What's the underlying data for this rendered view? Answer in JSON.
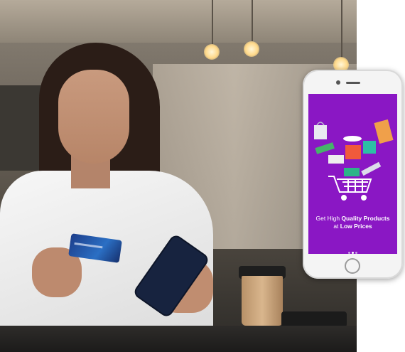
{
  "mockup": {
    "tagline_line1_prefix": "Get High ",
    "tagline_line1_bold": "Quality Products",
    "tagline_line2_prefix": "at ",
    "tagline_line2_bold": "Low Prices"
  },
  "colors": {
    "screen_background": "#8a17c4",
    "phone_body": "#f4f4f4"
  },
  "icons": [
    "shopping-cart-icon",
    "shopping-bag-icon",
    "gift-box-icon"
  ],
  "carousel": {
    "page_count": 3,
    "active_index": 1
  }
}
